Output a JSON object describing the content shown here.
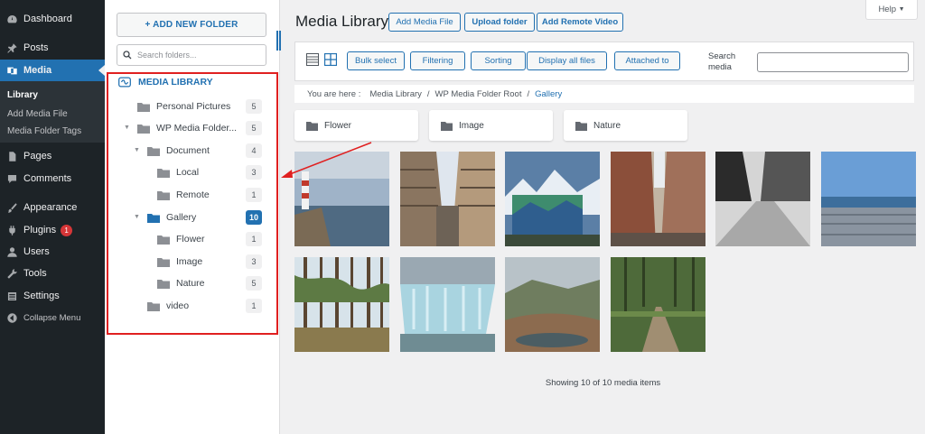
{
  "admin_menu": {
    "items": [
      {
        "label": "Dashboard",
        "icon": "dashboard-icon"
      },
      {
        "label": "Posts",
        "icon": "pin-icon"
      },
      {
        "label": "Media",
        "icon": "media-icon"
      },
      {
        "label": "Pages",
        "icon": "pages-icon"
      },
      {
        "label": "Comments",
        "icon": "comment-icon"
      },
      {
        "label": "Appearance",
        "icon": "brush-icon"
      },
      {
        "label": "Plugins",
        "icon": "plug-icon",
        "badge": "1"
      },
      {
        "label": "Users",
        "icon": "user-icon"
      },
      {
        "label": "Tools",
        "icon": "wrench-icon"
      },
      {
        "label": "Settings",
        "icon": "settings-icon"
      },
      {
        "label": "Collapse Menu",
        "icon": "collapse-icon"
      }
    ],
    "media_submenu": [
      "Library",
      "Add Media File",
      "Media Folder Tags"
    ],
    "active_color": "#2271b1"
  },
  "folder_panel": {
    "add_button": "+ ADD NEW FOLDER",
    "search_placeholder": "Search folders...",
    "root_label": "MEDIA LIBRARY",
    "tree": [
      {
        "label": "Personal Pictures",
        "count": "5"
      },
      {
        "label": "WP Media Folder...",
        "count": "5"
      },
      {
        "label": "Document",
        "count": "4"
      },
      {
        "label": "Local",
        "count": "3"
      },
      {
        "label": "Remote",
        "count": "1"
      },
      {
        "label": "Gallery",
        "count": "10"
      },
      {
        "label": "Flower",
        "count": "1"
      },
      {
        "label": "Image",
        "count": "3"
      },
      {
        "label": "Nature",
        "count": "5"
      },
      {
        "label": "video",
        "count": "1"
      }
    ],
    "highlight_color": "#e02020"
  },
  "main": {
    "title": "Media Library",
    "header_buttons": [
      "Add Media File",
      "Upload folder",
      "Add Remote Video"
    ],
    "help": "Help",
    "toolbar_buttons": [
      "Bulk select",
      "Filtering",
      "Sorting",
      "Display all files",
      "Attached to"
    ],
    "search_label": "Search media",
    "breadcrumb": {
      "prefix": "You are here :",
      "items": [
        "Media Library",
        "WP Media Folder Root"
      ],
      "current": "Gallery"
    },
    "folders": [
      "Flower",
      "Image",
      "Nature"
    ],
    "status": "Showing 10 of 10 media items"
  }
}
